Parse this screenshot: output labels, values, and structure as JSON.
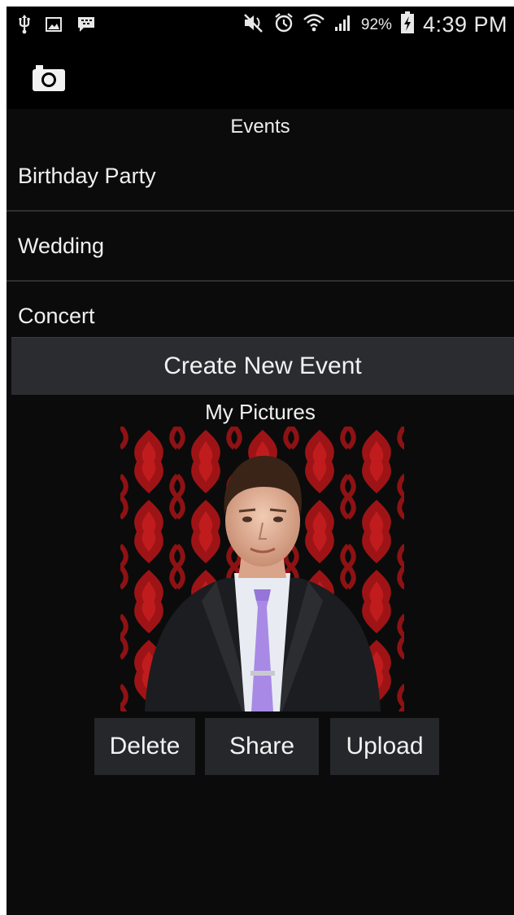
{
  "status_bar": {
    "battery_percent": "92%",
    "time": "4:39 PM",
    "left_icons": [
      "usb-icon",
      "image-icon",
      "bbm-icon"
    ],
    "right_icons": [
      "mute-icon",
      "alarm-icon",
      "wifi-icon",
      "signal-icon",
      "battery-charging-icon"
    ]
  },
  "action_bar": {
    "icon": "camera-icon"
  },
  "events": {
    "header": "Events",
    "items": [
      {
        "label": "Birthday Party"
      },
      {
        "label": "Wedding"
      },
      {
        "label": "Concert"
      }
    ],
    "create_label": "Create New Event"
  },
  "pictures": {
    "header": "My Pictures",
    "photo": "portrait-photo"
  },
  "actions": {
    "delete_label": "Delete",
    "share_label": "Share",
    "upload_label": "Upload"
  },
  "colors": {
    "background": "#0b0b0b",
    "button": "#2a2c30",
    "divider": "#2f2f31",
    "text": "#f0f0f0"
  }
}
